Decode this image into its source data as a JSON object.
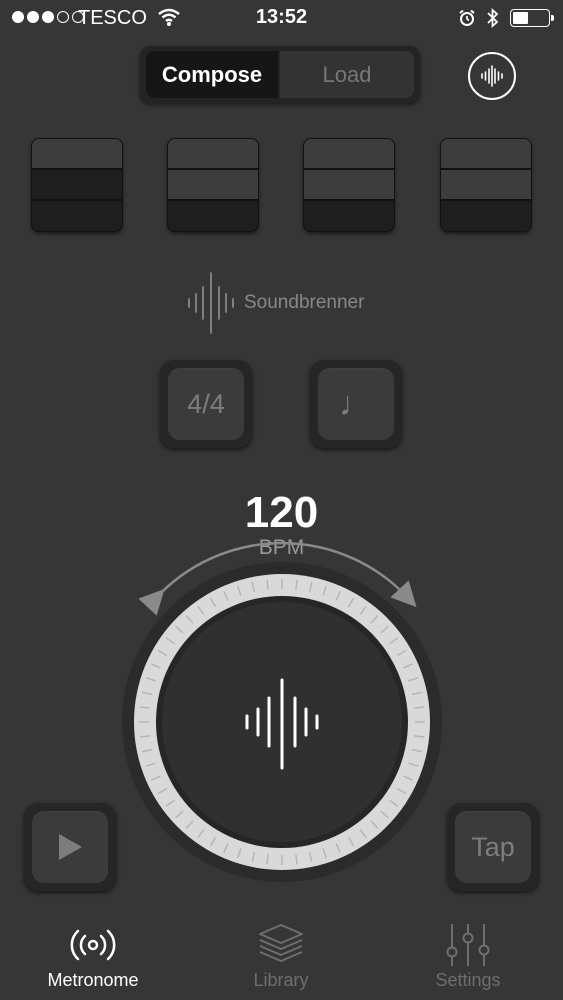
{
  "status_bar": {
    "carrier": "TESCO",
    "time": "13:52",
    "signal_bars_filled": 3,
    "signal_bars_total": 5,
    "battery_level": 0.4
  },
  "mode_switch": {
    "options": [
      "Compose",
      "Load"
    ],
    "selected": "Compose"
  },
  "beats": [
    {
      "filled_rows": 2
    },
    {
      "filled_rows": 1
    },
    {
      "filled_rows": 1
    },
    {
      "filled_rows": 1
    }
  ],
  "brand": {
    "name": "Soundbrenner"
  },
  "controls": {
    "time_signature": "4/4",
    "note_value": "♩"
  },
  "tempo": {
    "value": "120",
    "unit": "BPM"
  },
  "tap_button": {
    "label": "Tap"
  },
  "tabs": [
    {
      "label": "Metronome",
      "icon": "metronome-icon",
      "active": true
    },
    {
      "label": "Library",
      "icon": "library-icon",
      "active": false
    },
    {
      "label": "Settings",
      "icon": "settings-icon",
      "active": false
    }
  ],
  "colors": {
    "background": "#363636",
    "active_tab": "#ffffff",
    "inactive_tab": "#6e6e6e"
  }
}
